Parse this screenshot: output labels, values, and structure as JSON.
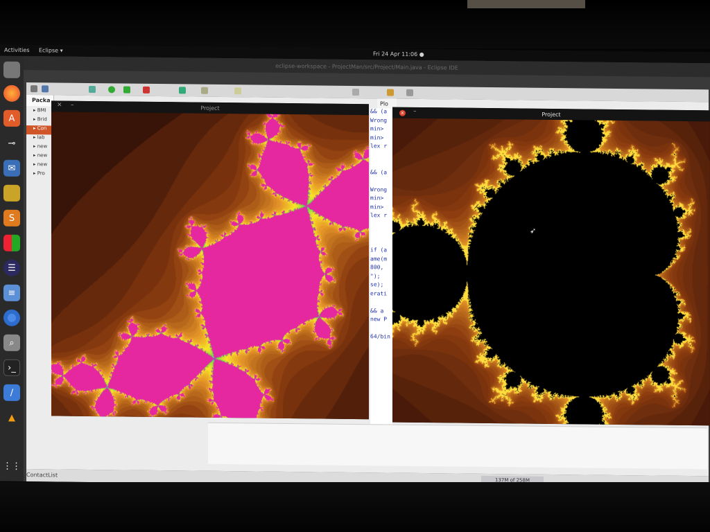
{
  "topbar": {
    "activities": "Activities",
    "app_menu": "Eclipse ▾",
    "clock": "Fri 24 Apr  11:06 ●"
  },
  "eclipse": {
    "title": "eclipse-workspace - ProjectMan/src/Project/Main.java - Eclipse IDE",
    "package_explorer_tab": "Packa",
    "packages": [
      "BMI",
      "Brid",
      "Con",
      "lab",
      "new",
      "new",
      "new",
      "Pro"
    ],
    "selected_package_index": 2,
    "editor_tab": "Plo",
    "editor_fragments": [
      "&& (a",
      "Wrong",
      " min>",
      " min>",
      "lex r",
      "",
      "",
      "&& (a",
      "",
      "Wrong",
      " min>",
      " min>",
      "lex r",
      "",
      "",
      "",
      "if (a",
      "ame(m",
      "800, ",
      "\");",
      "se);",
      "erati",
      "",
      "&& a",
      "new P",
      "",
      "64/bin"
    ],
    "status_left": "ContactList",
    "heap": "137M of 258M"
  },
  "julia_window": {
    "title": "Project",
    "close_icon": "close-icon",
    "minimize_label": "–"
  },
  "mandelbrot_window": {
    "title": "Project",
    "close_label": "x",
    "minimize_label": "–"
  },
  "dock_icons": [
    "files-icon",
    "firefox-icon",
    "software-center-icon",
    "screenshot-icon",
    "mail-icon",
    "teapot-icon",
    "sublime-icon",
    "windows-icon",
    "eclipse-icon",
    "text-editor-icon",
    "chrome-icon",
    "search-icon",
    "terminal-icon",
    "pen-icon",
    "vlc-icon",
    "apps-grid-icon"
  ]
}
